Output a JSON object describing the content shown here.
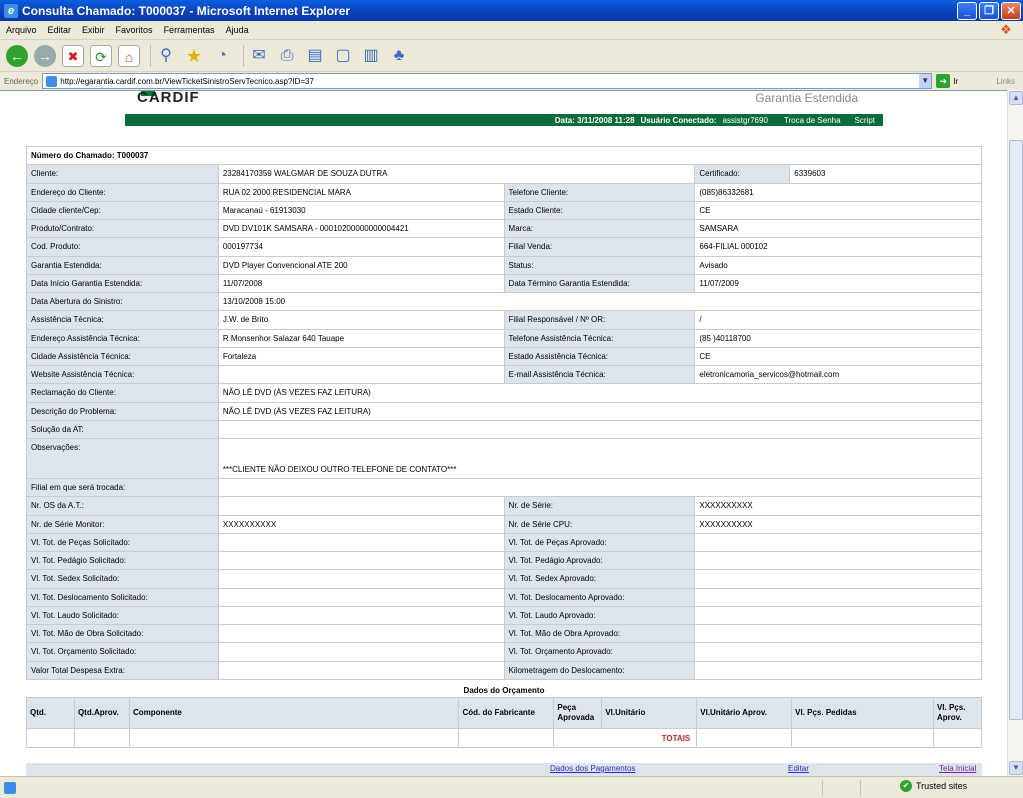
{
  "window": {
    "title": "Consulta Chamado: T000037 - Microsoft Internet Explorer",
    "menu": [
      "Arquivo",
      "Editar",
      "Exibir",
      "Favoritos",
      "Ferramentas",
      "Ajuda"
    ],
    "address_label": "Endereço",
    "url": "http://egarantia.cardif.com.br/ViewTicketSinistroServTecnico.asp?ID=37",
    "go_label": "Ir",
    "links_label": "Links",
    "status_zone": "Trusted sites"
  },
  "banner": {
    "logo": "CARDIF",
    "product": "Garantia Estendida",
    "date_label": "Data: 3/11/2008 11:28",
    "user_label": "Usuário Conectado:",
    "user": "assistgr7690",
    "change_password": "Troca de Senha",
    "script": "Script"
  },
  "ticket": {
    "header": "Número do Chamado: T000037",
    "client_label": "Cliente:",
    "client_value": "23284170359  WALGMAR DE SOUZA DUTRA",
    "certificate_label": "Certificado:",
    "certificate_value": "6339603",
    "rows": [
      {
        "l1": "Endereço do Cliente:",
        "v1": "RUA 02   2000     RESIDENCIAL MARA",
        "l2": "Telefone Cliente:",
        "v2": "(085)86332681"
      },
      {
        "l1": "Cidade cliente/Cep:",
        "v1": "Maracanaú - 61913030",
        "l2": "Estado Cliente:",
        "v2": "CE"
      },
      {
        "l1": "Produto/Contrato:",
        "v1": "DVD DV101K SAMSARA - 00010200000000004421",
        "l2": "Marca:",
        "v2": "SAMSARA"
      },
      {
        "l1": "Cod. Produto:",
        "v1": "000197734",
        "l2": "Filial Venda:",
        "v2": "664-FILIAL 000102"
      },
      {
        "l1": "Garantia Estendida:",
        "v1": "DVD Player Convencional ATE 200",
        "l2": "Status:",
        "v2": "Avisado"
      },
      {
        "l1": "Data Início Garantia Estendida:",
        "v1": "11/07/2008",
        "l2": "Data Término Garantia Estendida:",
        "v2": "11/07/2009"
      }
    ],
    "opening_label": "Data Abertura do Sinistro:",
    "opening_value": "13/10/2008 15:00",
    "rows2": [
      {
        "l1": "Assistência Técnica:",
        "v1": "J.W. de Brito",
        "l2": "Filial Responsável / Nº OR:",
        "v2": "/"
      },
      {
        "l1": "Endereço Assistência Técnica:",
        "v1": "R Monsenhor Salazar   640     Tauape",
        "l2": "Telefone Assistência Técnica:",
        "v2": "(85 )40118700"
      },
      {
        "l1": "Cidade Assistência Técnica:",
        "v1": "Fortaleza",
        "l2": "Estado Assistência Técnica:",
        "v2": "CE"
      },
      {
        "l1": "Website Assistência Técnica:",
        "v1": "",
        "l2": "E-mail Assistência Técnica:",
        "v2": "eletronicamoria_servicos@hotmail.com"
      }
    ],
    "complaint_label": "Reclamação do Cliente:",
    "complaint_value": "NÃO LÊ DVD (ÀS VEZES FAZ LEITURA)",
    "problem_label": "Descrição do Problema:",
    "problem_value": "NÃO LÊ DVD (ÀS VEZES FAZ LEITURA)",
    "solution_label": "Solução da AT:",
    "solution_value": "",
    "notes_label": "Observações:",
    "notes_value": "***CLIENTE NÃO DEIXOU OUTRO TELEFONE DE CONTATO***",
    "branch_label": "Filial em que será trocada:",
    "branch_value": "",
    "rows3": [
      {
        "l1": "Nr. OS da A.T.:",
        "v1": "",
        "l2": "Nr. de Série:",
        "v2": "XXXXXXXXXX"
      },
      {
        "l1": "Nr. de Série Monitor:",
        "v1": "XXXXXXXXXX",
        "l2": "Nr. de Série CPU:",
        "v2": "XXXXXXXXXX"
      },
      {
        "l1": "Vl. Tot. de Peças Solicitado:",
        "v1": "",
        "l2": "Vl. Tot. de Peças Aprovado:",
        "v2": ""
      },
      {
        "l1": "Vl. Tot. Pedágio Solicitado:",
        "v1": "",
        "l2": "Vl. Tot. Pedágio Aprovado:",
        "v2": ""
      },
      {
        "l1": "Vl. Tot. Sedex Solicitado:",
        "v1": "",
        "l2": "Vl. Tot. Sedex Aprovado:",
        "v2": ""
      },
      {
        "l1": "Vl. Tot. Deslocamento Solicitado:",
        "v1": "",
        "l2": "Vl. Tot. Deslocamento Aprovado:",
        "v2": ""
      },
      {
        "l1": "Vl. Tot. Laudo Solicitado:",
        "v1": "",
        "l2": "Vl. Tot. Laudo Aprovado:",
        "v2": ""
      },
      {
        "l1": "Vl. Tot. Mão de Obra Solicitado:",
        "v1": "",
        "l2": "Vl. Tot. Mão de Obra Aprovado:",
        "v2": ""
      },
      {
        "l1": "Vl. Tot. Orçamento Solicitado:",
        "v1": "",
        "l2": "Vl. Tot. Orçamento Aprovado:",
        "v2": ""
      },
      {
        "l1": "Valor Total Despesa Extra:",
        "v1": "",
        "l2": "Kilometragem do Deslocamento:",
        "v2": ""
      }
    ]
  },
  "budget": {
    "title": "Dados do Orçamento",
    "headers": [
      "Qtd.",
      "Qtd.Aprov.",
      "Componente",
      "Cód. do Fabricante",
      "Peça Aprovada",
      "Vl.Unitário",
      "Vl.Unitário Aprov.",
      "Vl. Pçs. Pedidas",
      "Vl. Pçs. Aprov."
    ],
    "totals_label": "TOTAIS"
  },
  "footer": {
    "payments": "Dados dos Pagamentos",
    "edit": "Editar",
    "home": "Tela Inicial"
  }
}
